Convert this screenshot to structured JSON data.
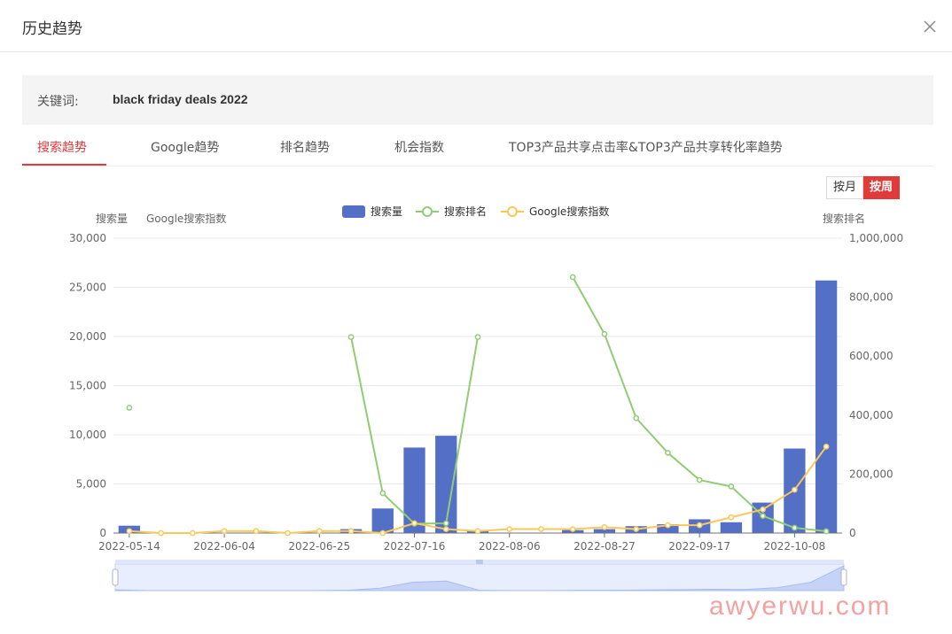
{
  "modal": {
    "title": "历史趋势",
    "close_icon": "close-icon"
  },
  "keyword": {
    "label": "关键词:",
    "value": "black friday deals 2022"
  },
  "tabs": [
    {
      "label": "搜索趋势",
      "active": true
    },
    {
      "label": "Google趋势",
      "active": false
    },
    {
      "label": "排名趋势",
      "active": false
    },
    {
      "label": "机会指数",
      "active": false
    },
    {
      "label": "TOP3产品共享点击率&TOP3产品共享转化率趋势",
      "active": false
    }
  ],
  "toggle": {
    "month": "按月",
    "week": "按周",
    "active": "week"
  },
  "colors": {
    "bar": "#5470c6",
    "rank": "#91cc75",
    "google": "#fac858",
    "accent": "#e03a3a"
  },
  "watermark": "awyerwu.com",
  "chart_data": {
    "type": "bar",
    "axis_titles": {
      "left_1": "搜索量",
      "left_2": "Google搜索指数",
      "right": "搜索排名"
    },
    "legend": [
      "搜索量",
      "搜索排名",
      "Google搜索指数"
    ],
    "legend_position": "top-center",
    "grid": true,
    "x": [
      "2022-05-14",
      "2022-05-21",
      "2022-05-28",
      "2022-06-04",
      "2022-06-11",
      "2022-06-18",
      "2022-06-25",
      "2022-07-02",
      "2022-07-09",
      "2022-07-16",
      "2022-07-23",
      "2022-07-30",
      "2022-08-06",
      "2022-08-13",
      "2022-08-20",
      "2022-08-27",
      "2022-09-03",
      "2022-09-10",
      "2022-09-17",
      "2022-09-24",
      "2022-10-01",
      "2022-10-08",
      "2022-10-15"
    ],
    "x_tick_labels": [
      "2022-05-14",
      "2022-06-04",
      "2022-06-25",
      "2022-07-16",
      "2022-08-06",
      "2022-08-27",
      "2022-09-17",
      "2022-10-08"
    ],
    "y_left": {
      "ticks": [
        "0",
        "5,000",
        "10,000",
        "15,000",
        "20,000",
        "25,000",
        "30,000"
      ],
      "range": [
        0,
        30000
      ]
    },
    "y_right": {
      "ticks": [
        "0",
        "200,000",
        "400,000",
        "600,000",
        "800,000",
        "1,000,000"
      ],
      "range": [
        0,
        1000000
      ]
    },
    "series": [
      {
        "name": "搜索量",
        "type": "bar",
        "axis": "left",
        "values": [
          750,
          0,
          0,
          0,
          0,
          0,
          0,
          400,
          2500,
          8700,
          9900,
          300,
          0,
          0,
          300,
          400,
          700,
          900,
          1400,
          1100,
          3100,
          8600,
          25700
        ]
      },
      {
        "name": "搜索排名",
        "type": "line",
        "axis": "right",
        "values": [
          425000,
          null,
          null,
          null,
          null,
          null,
          null,
          665000,
          135000,
          32000,
          33000,
          665000,
          null,
          null,
          868000,
          675000,
          390000,
          272000,
          180000,
          158000,
          58000,
          18000,
          6000
        ]
      },
      {
        "name": "Google搜索指数",
        "type": "line",
        "axis": "left",
        "values": [
          200,
          0,
          0,
          200,
          200,
          0,
          200,
          200,
          0,
          1000,
          400,
          200,
          400,
          400,
          400,
          600,
          400,
          800,
          800,
          1600,
          2400,
          4400,
          8800
        ]
      }
    ]
  }
}
